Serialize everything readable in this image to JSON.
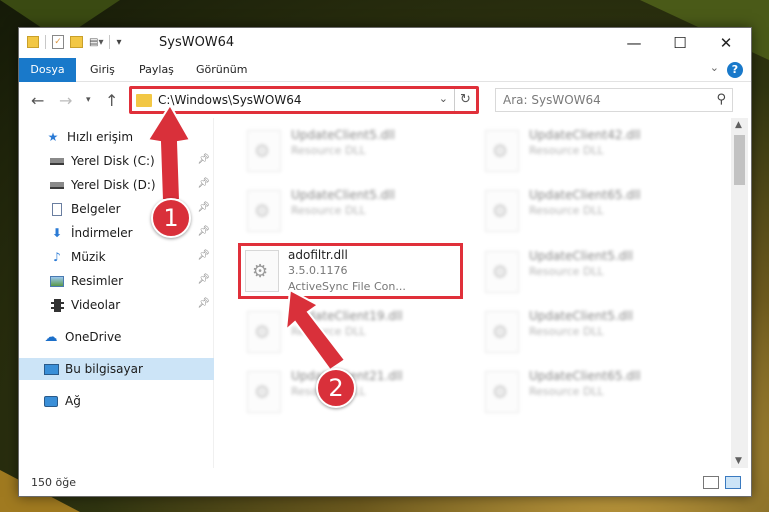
{
  "window": {
    "title": "SysWOW64"
  },
  "ribbon": {
    "tabs": [
      "Dosya",
      "Giriş",
      "Paylaş",
      "Görünüm"
    ]
  },
  "address": {
    "path": "C:\\Windows\\SysWOW64"
  },
  "search": {
    "placeholder": "Ara: SysWOW64"
  },
  "sidebar": {
    "items": [
      {
        "label": "Hızlı erişim",
        "icon": "star-icon"
      },
      {
        "label": "Yerel Disk (C:)",
        "icon": "drive-icon"
      },
      {
        "label": "Yerel Disk (D:)",
        "icon": "drive-icon"
      },
      {
        "label": "Belgeler",
        "icon": "documents-icon"
      },
      {
        "label": "İndirmeler",
        "icon": "downloads-icon"
      },
      {
        "label": "Müzik",
        "icon": "music-icon"
      },
      {
        "label": "Resimler",
        "icon": "pictures-icon"
      },
      {
        "label": "Videolar",
        "icon": "videos-icon"
      },
      {
        "label": "OneDrive",
        "icon": "cloud-icon"
      },
      {
        "label": "Bu bilgisayar",
        "icon": "computer-icon"
      },
      {
        "label": "Ağ",
        "icon": "network-icon"
      }
    ]
  },
  "files": {
    "left": [
      {
        "name": "UpdateClient5.dll",
        "type": "Resource DLL"
      },
      {
        "name": "UpdateClient5.dll",
        "type": "Resource DLL"
      },
      {
        "name": "adofiltr.dll",
        "version": "3.5.0.1176",
        "desc": "ActiveSync File Con..."
      },
      {
        "name": "UpdateClient19.dll",
        "type": "Resource DLL"
      },
      {
        "name": "UpdateClient21.dll",
        "type": "Resource DLL"
      }
    ],
    "right": [
      {
        "name": "UpdateClient42.dll",
        "type": "Resource DLL"
      },
      {
        "name": "UpdateClient65.dll",
        "type": "Resource DLL"
      },
      {
        "name": "UpdateClient5.dll",
        "type": "Resource DLL"
      },
      {
        "name": "UpdateClient5.dll",
        "type": "Resource DLL"
      },
      {
        "name": "UpdateClient65.dll",
        "type": "Resource DLL"
      }
    ]
  },
  "status": {
    "count": "150 öğe"
  },
  "annotations": {
    "badge1": "1",
    "badge2": "2"
  },
  "colors": {
    "accent": "#1979ca",
    "highlight": "#e0303a"
  }
}
